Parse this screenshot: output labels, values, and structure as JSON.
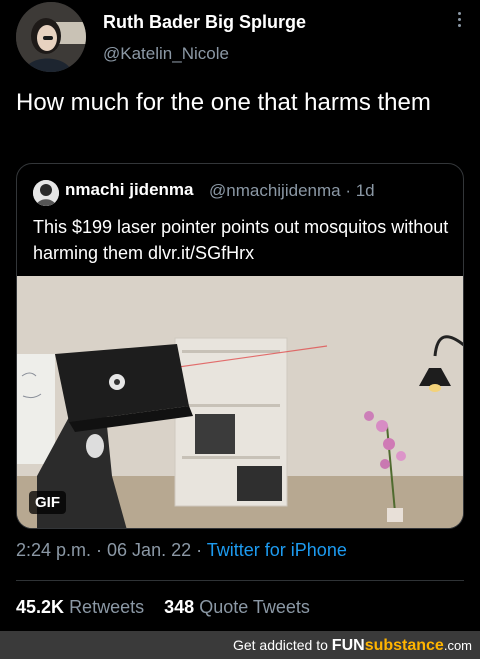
{
  "tweet": {
    "author_name": "Ruth Bader Big Splurge",
    "author_handle": "@Katelin_Nicole",
    "text": "How much for the one that harms them",
    "timestamp": "2:24 p.m. · 06 Jan. 22 · ",
    "source": "Twitter for iPhone",
    "retweets_count": "45.2K",
    "retweets_label": "Retweets",
    "quotes_count": "348",
    "quotes_label": "Quote Tweets"
  },
  "quoted_tweet": {
    "author_name": "nmachi jidenma",
    "author_handle": "@nmachijidenma · 1d",
    "text": "This $199 laser pointer points out mosquitos without harming them dlvr.it/SGfHrx",
    "media_badge": "GIF"
  },
  "footer": {
    "prefix": "Get addicted to ",
    "brand_part1": "FUN",
    "brand_part2": "substance",
    "domain": ".com"
  },
  "icons": {
    "more": "more-vertical-icon"
  },
  "colors": {
    "background": "#000000",
    "link": "#1d9bf0",
    "muted": "#8b98a5",
    "brand_accent": "#ffb400"
  }
}
